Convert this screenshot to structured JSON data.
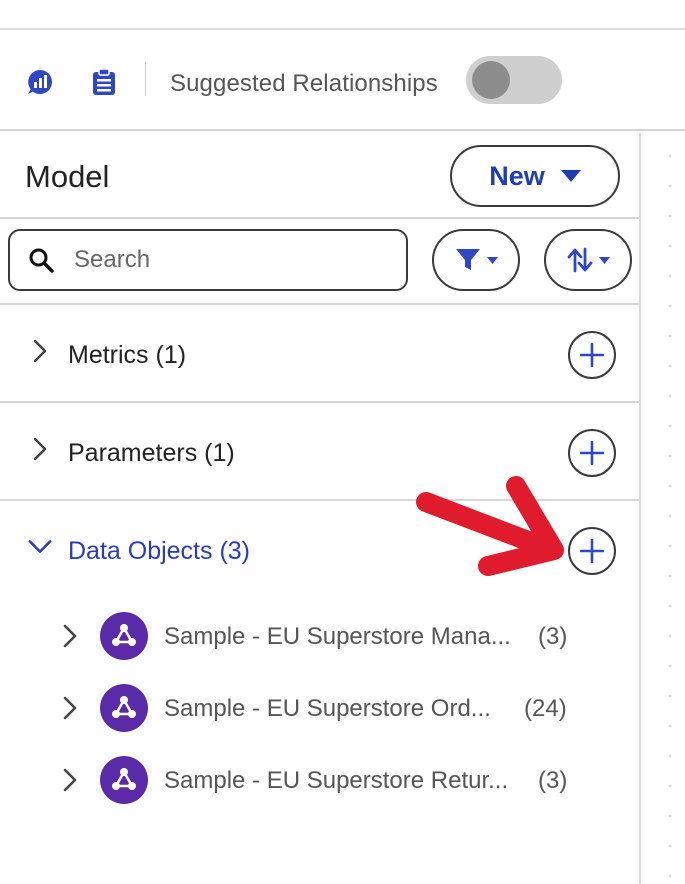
{
  "toolbar": {
    "icons": [
      "chart-bubble-icon",
      "clipboard-icon"
    ],
    "suggested_label": "Suggested Relationships",
    "suggested_enabled": false
  },
  "panel": {
    "title": "Model",
    "new_label": "New",
    "search_placeholder": "Search"
  },
  "sections": [
    {
      "label": "Metrics (1)",
      "expanded": false
    },
    {
      "label": "Parameters (1)",
      "expanded": false
    },
    {
      "label": "Data Objects (3)",
      "expanded": true
    }
  ],
  "data_objects": [
    {
      "name": "Sample - EU Superstore Mana...",
      "count": "(3)"
    },
    {
      "name": "Sample - EU Superstore Ord...",
      "count": "(24)"
    },
    {
      "name": "Sample - EU Superstore Retur...",
      "count": "(3)"
    }
  ],
  "colors": {
    "accent": "#2b3cb8",
    "object_icon": "#5a2aa8",
    "annotation_arrow": "#e01b2e"
  }
}
